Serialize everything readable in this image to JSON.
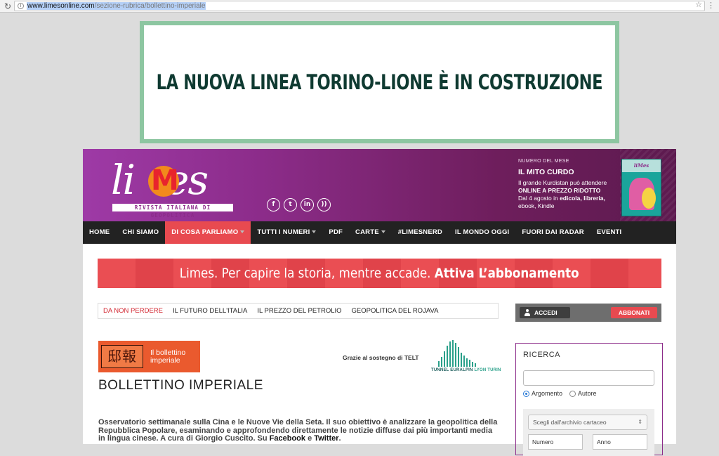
{
  "browser": {
    "url_host": "www.limesonline.com",
    "url_path": "/sezione-rubrica/bollettino-imperiale"
  },
  "banner": {
    "text": "LA NUOVA LINEA TORINO-LIONE È IN COSTRUZIONE"
  },
  "header": {
    "logo_word_left": "li",
    "logo_m": "M",
    "logo_word_right": "es",
    "tagline": "RIVISTA ITALIANA DI GEOPOLITICA",
    "socials": [
      {
        "glyph": "f",
        "icon": "facebook-icon"
      },
      {
        "glyph": "t",
        "icon": "twitter-icon"
      },
      {
        "glyph": "in",
        "icon": "linkedin-icon"
      },
      {
        "glyph": "))",
        "icon": "rss-icon"
      }
    ],
    "issue": {
      "label": "NUMERO DEL MESE",
      "title": "IL MITO CURDO",
      "line1": "Il grande Kurdistan può attendere",
      "line2": "ONLINE A PREZZO RIDOTTO",
      "line3_prefix": "Dal 4 agosto in ",
      "line3_bold": "edicola, libreria,",
      "line4": "ebook, Kindle",
      "cover_text": "liMes"
    }
  },
  "nav": {
    "items": [
      {
        "label": "HOME"
      },
      {
        "label": "CHI SIAMO"
      },
      {
        "label": "DI COSA PARLIAMO"
      },
      {
        "label": "TUTTI I NUMERI"
      },
      {
        "label": "PDF"
      },
      {
        "label": "CARTE"
      },
      {
        "label": "#LIMESNERD"
      },
      {
        "label": "IL MONDO OGGI"
      },
      {
        "label": "FUORI DAI RADAR"
      },
      {
        "label": "EVENTI"
      }
    ]
  },
  "promo": {
    "text": "Limes. Per capire la storia, mentre accade.",
    "cta": "Attiva L’abbonamento"
  },
  "dnp": {
    "label": "DA NON PERDERE",
    "links": [
      "IL FUTURO DELL'ITALIA",
      "IL PREZZO DEL PETROLIO",
      "GEOPOLITICA DEL ROJAVA"
    ]
  },
  "userbar": {
    "login": "ACCEDI",
    "subscribe": "ABBONATI"
  },
  "article": {
    "logo_chars": "邸報",
    "logo_line1": "Il bollettino",
    "logo_line2": "imperiale",
    "sponsor": "Grazie al sostegno di TELT",
    "telt_a": "TUNNEL EURALPIN",
    "telt_b": "LYON TURIN",
    "title": "BOLLETTINO IMPERIALE",
    "intro_1": "Osservatorio settimanale sulla Cina e le Nuove Vie della Seta. Il suo obiettivo è analizzare la geopolitica della Repubblica Popolare, esaminando e approfondendo direttamente le notizie diffuse dai più importanti media in lingua cinese. A cura di Giorgio Cuscito. Su ",
    "intro_fb": "Facebook",
    "intro_and": " e ",
    "intro_tw": "Twitter",
    "intro_end": "."
  },
  "search": {
    "title": "RICERCA",
    "radio_1": "Argomento",
    "radio_2": "Autore",
    "archive_placeholder": "Scegli dall'archivio cartaceo",
    "field_numero": "Numero",
    "field_anno": "Anno"
  },
  "colors": {
    "accent": "#e84a50",
    "brand_purple": "#8c2c8a",
    "banner_border": "#8dc6a1",
    "banner_text": "#0f3a31"
  }
}
